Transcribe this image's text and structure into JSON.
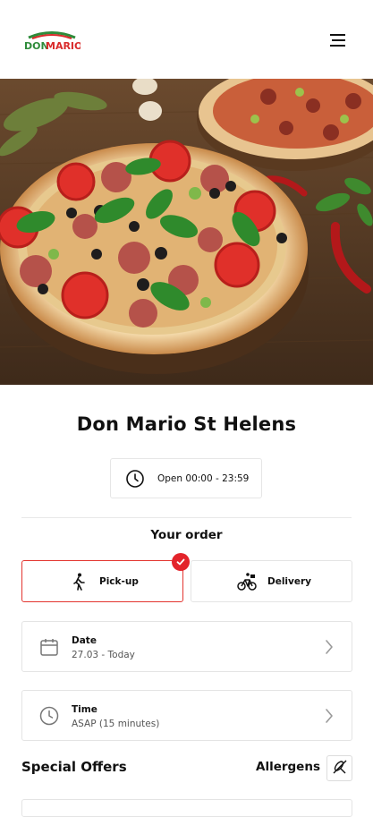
{
  "header": {
    "logo_text": "DON MARIO",
    "menu_icon": "hamburger-menu-icon"
  },
  "hero": {
    "image": "pizza-photo"
  },
  "restaurant": {
    "name": "Don Mario St Helens",
    "hours": "Open 00:00 - 23:59"
  },
  "order": {
    "heading": "Your order",
    "options": [
      {
        "label": "Pick-up",
        "icon": "walking-person-icon",
        "selected": true
      },
      {
        "label": "Delivery",
        "icon": "bicycle-delivery-icon",
        "selected": false
      }
    ],
    "date": {
      "label": "Date",
      "value": "27.03 - Today",
      "icon": "calendar-icon"
    },
    "time": {
      "label": "Time",
      "value": "ASAP (15 minutes)",
      "icon": "clock-icon"
    }
  },
  "offers": {
    "heading": "Special Offers",
    "allergens_label": "Allergens",
    "allergens_icon": "no-wheat-icon"
  },
  "colors": {
    "accent": "#e3242b",
    "border": "#e4e4e4",
    "text": "#111111",
    "muted": "#555555"
  }
}
